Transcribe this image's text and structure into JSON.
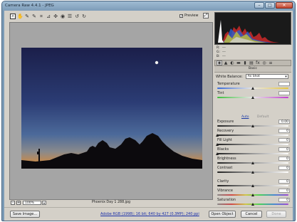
{
  "window": {
    "title": "Camera Raw 4.4.1  -  JPEG",
    "minimize": "–",
    "maximize": "□",
    "close": "✕"
  },
  "toolbar": {
    "tools": [
      "zoom-icon",
      "hand-icon",
      "eyedropper-icon",
      "color-sampler-icon",
      "crop-icon",
      "straighten-icon",
      "retouch-icon",
      "redeye-icon",
      "prefs-icon",
      "rotate-left-icon",
      "rotate-right-icon"
    ],
    "glyphs": [
      "⌕",
      "✋",
      "✎",
      "✎",
      "⌗",
      "⊿",
      "✜",
      "◉",
      "☰",
      "↺",
      "↻"
    ],
    "preview_label": "Preview",
    "preview_checked": "✓",
    "fullscreen_glyph": "⤢"
  },
  "status": {
    "zoom_out": "-",
    "zoom_in": "+",
    "zoom_value": "100%",
    "zoom_arrow": "▾",
    "filename": "Phoenix Day 1 288.jpg"
  },
  "rgb": {
    "r_label": "R:",
    "r_value": "---",
    "g_label": "G:",
    "g_value": "---",
    "b_label": "B:",
    "b_value": "---"
  },
  "panel": {
    "tab_glyphs": [
      "◉",
      "▲",
      "◐",
      "▬",
      "▮",
      "▤",
      "fx",
      "◎",
      "≡"
    ],
    "section_title": "Basic",
    "white_balance_label": "White Balance:",
    "white_balance_value": "As Shot",
    "auto_label": "Auto",
    "default_label": "Default",
    "controls": [
      {
        "label": "Temperature",
        "value": "",
        "pos": 0.5,
        "track": "temp"
      },
      {
        "label": "Tint",
        "value": "",
        "pos": 0.5,
        "track": "tint"
      },
      {
        "label": "Exposure",
        "value": "0.00",
        "pos": 0.5,
        "track": "gray"
      },
      {
        "label": "Recovery",
        "value": "0",
        "pos": 0.0,
        "track": "gray"
      },
      {
        "label": "Fill Light",
        "value": "0",
        "pos": 0.0,
        "track": "gray"
      },
      {
        "label": "Blacks",
        "value": "0",
        "pos": 0.0,
        "track": "gray"
      },
      {
        "label": "Brightness",
        "value": "0",
        "pos": 0.5,
        "track": "gray"
      },
      {
        "label": "Contrast",
        "value": "0",
        "pos": 0.5,
        "track": "gray"
      },
      {
        "label": "Clarity",
        "value": "0",
        "pos": 0.5,
        "track": "gray"
      },
      {
        "label": "Vibrance",
        "value": "0",
        "pos": 0.5,
        "track": "vib"
      },
      {
        "label": "Saturation",
        "value": "0",
        "pos": 0.5,
        "track": "sat"
      }
    ]
  },
  "footer": {
    "save_label": "Save Image...",
    "workflow_link": "Adobe RGB (1998); 16 bit; 640 by 427 (0.3MP); 240 ppi",
    "open_label": "Open Object",
    "cancel_label": "Cancel",
    "done_label": "Done"
  },
  "colors": {
    "sky_top": "#1b1f4a",
    "sky_mid": "#3f5a8c",
    "horizon": "#c88a4a",
    "accent_link": "#1a2fa8"
  }
}
